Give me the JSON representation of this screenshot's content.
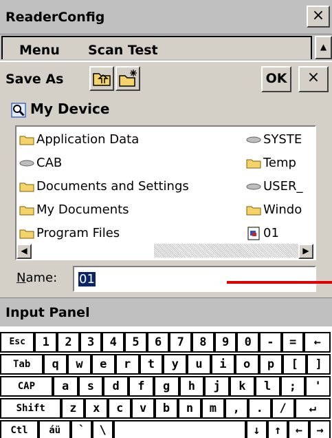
{
  "app": {
    "title": "ReaderConfig",
    "close_glyph": "×"
  },
  "menubar": {
    "items": [
      "Menu",
      "Scan Test"
    ],
    "scroll_up_glyph": "▲"
  },
  "dialog": {
    "title": "Save As",
    "ok_label": "OK",
    "close_glyph": "×",
    "location": "My Device",
    "files": [
      {
        "name": "Application Data",
        "icon": "folder-icon"
      },
      {
        "name": "CAB",
        "icon": "drive-icon"
      },
      {
        "name": "Documents and Settings",
        "icon": "folder-icon"
      },
      {
        "name": "My Documents",
        "icon": "folder-icon"
      },
      {
        "name": "Program Files",
        "icon": "folder-icon"
      },
      {
        "name": "SYSTE",
        "icon": "drive-icon"
      },
      {
        "name": "Temp",
        "icon": "folder-icon"
      },
      {
        "name": "USER_",
        "icon": "drive-icon"
      },
      {
        "name": "Windo",
        "icon": "folder-icon"
      },
      {
        "name": "01",
        "icon": "file-icon"
      }
    ],
    "name_label_first": "N",
    "name_label_rest": "ame:",
    "name_value": "01"
  },
  "input_panel": {
    "title": "Input Panel"
  },
  "keyboard": {
    "rows": [
      [
        "Esc",
        "1",
        "2",
        "3",
        "4",
        "5",
        "6",
        "7",
        "8",
        "9",
        "0",
        "-",
        "=",
        "←"
      ],
      [
        "Tab",
        "q",
        "w",
        "e",
        "r",
        "t",
        "y",
        "u",
        "i",
        "o",
        "p",
        "[",
        "]"
      ],
      [
        "CAP",
        "a",
        "s",
        "d",
        "f",
        "g",
        "h",
        "j",
        "k",
        "l",
        ";",
        "'"
      ],
      [
        "Shift",
        "z",
        "x",
        "c",
        "v",
        "b",
        "n",
        "m",
        ",",
        ".",
        "/",
        "↵"
      ],
      [
        "Ctl",
        "áü",
        "`",
        "\\",
        "",
        "↓",
        "↑",
        "←",
        "→"
      ]
    ]
  },
  "colors": {
    "selection": "#0a246a",
    "annotation": "#e00000",
    "folder": "#f5d36b"
  }
}
